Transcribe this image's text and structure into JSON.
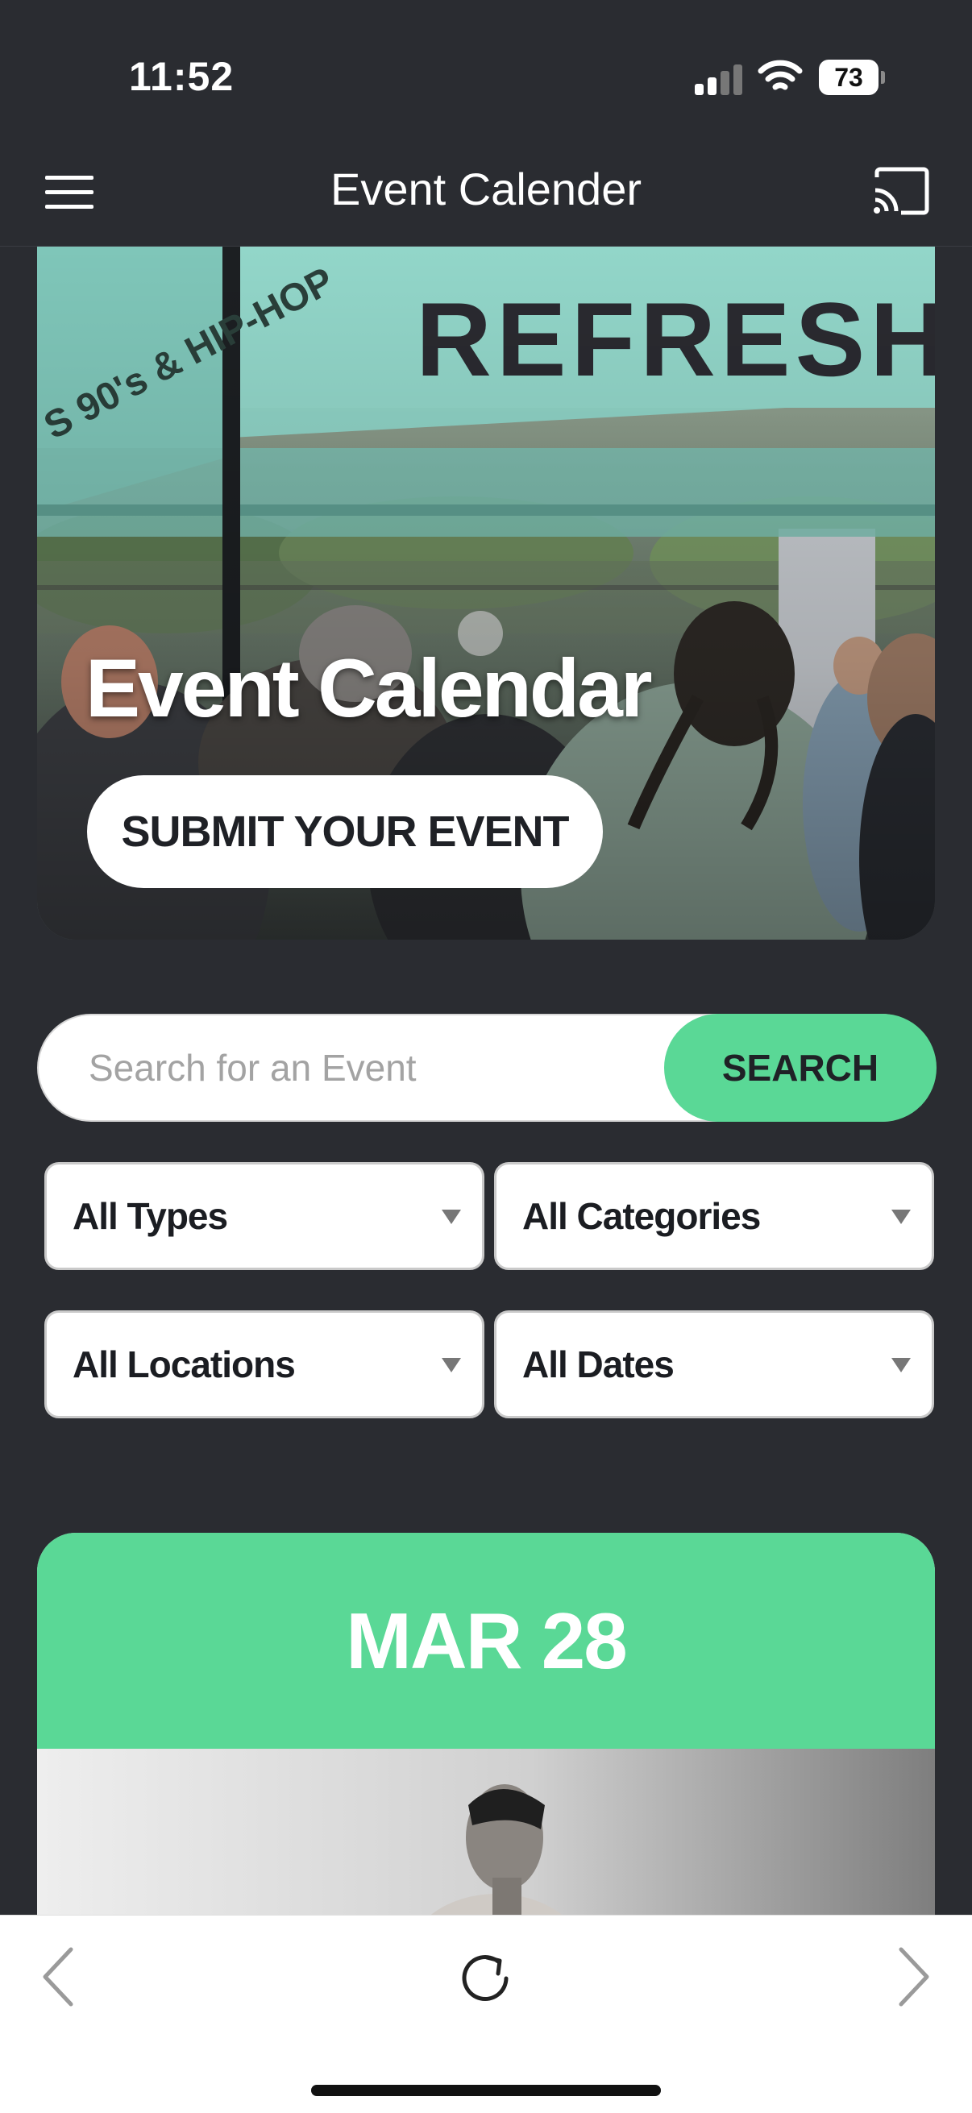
{
  "status_bar": {
    "time": "11:52",
    "battery": "73",
    "icons": [
      "signal-icon",
      "wifi-icon",
      "battery-icon"
    ]
  },
  "header": {
    "title": "Event Calender",
    "icons": [
      "menu-icon",
      "cast-icon"
    ]
  },
  "hero": {
    "tent_text": "REFRESHI",
    "title": "Event Calendar",
    "button_label": "SUBMIT YOUR EVENT"
  },
  "search": {
    "placeholder": "Search for an Event",
    "value": "",
    "button_label": "SEARCH"
  },
  "filters": [
    {
      "label": "All Types"
    },
    {
      "label": "All Categories"
    },
    {
      "label": "All Locations"
    },
    {
      "label": "All Dates"
    }
  ],
  "event": {
    "date": "MAR 28"
  },
  "bottom_bar": {
    "icons": [
      "back-icon",
      "reload-icon",
      "forward-icon"
    ]
  },
  "colors": {
    "background": "#2a2c31",
    "accent_green": "#5ad896",
    "tent_teal": "#8fd3c6",
    "white": "#ffffff"
  }
}
